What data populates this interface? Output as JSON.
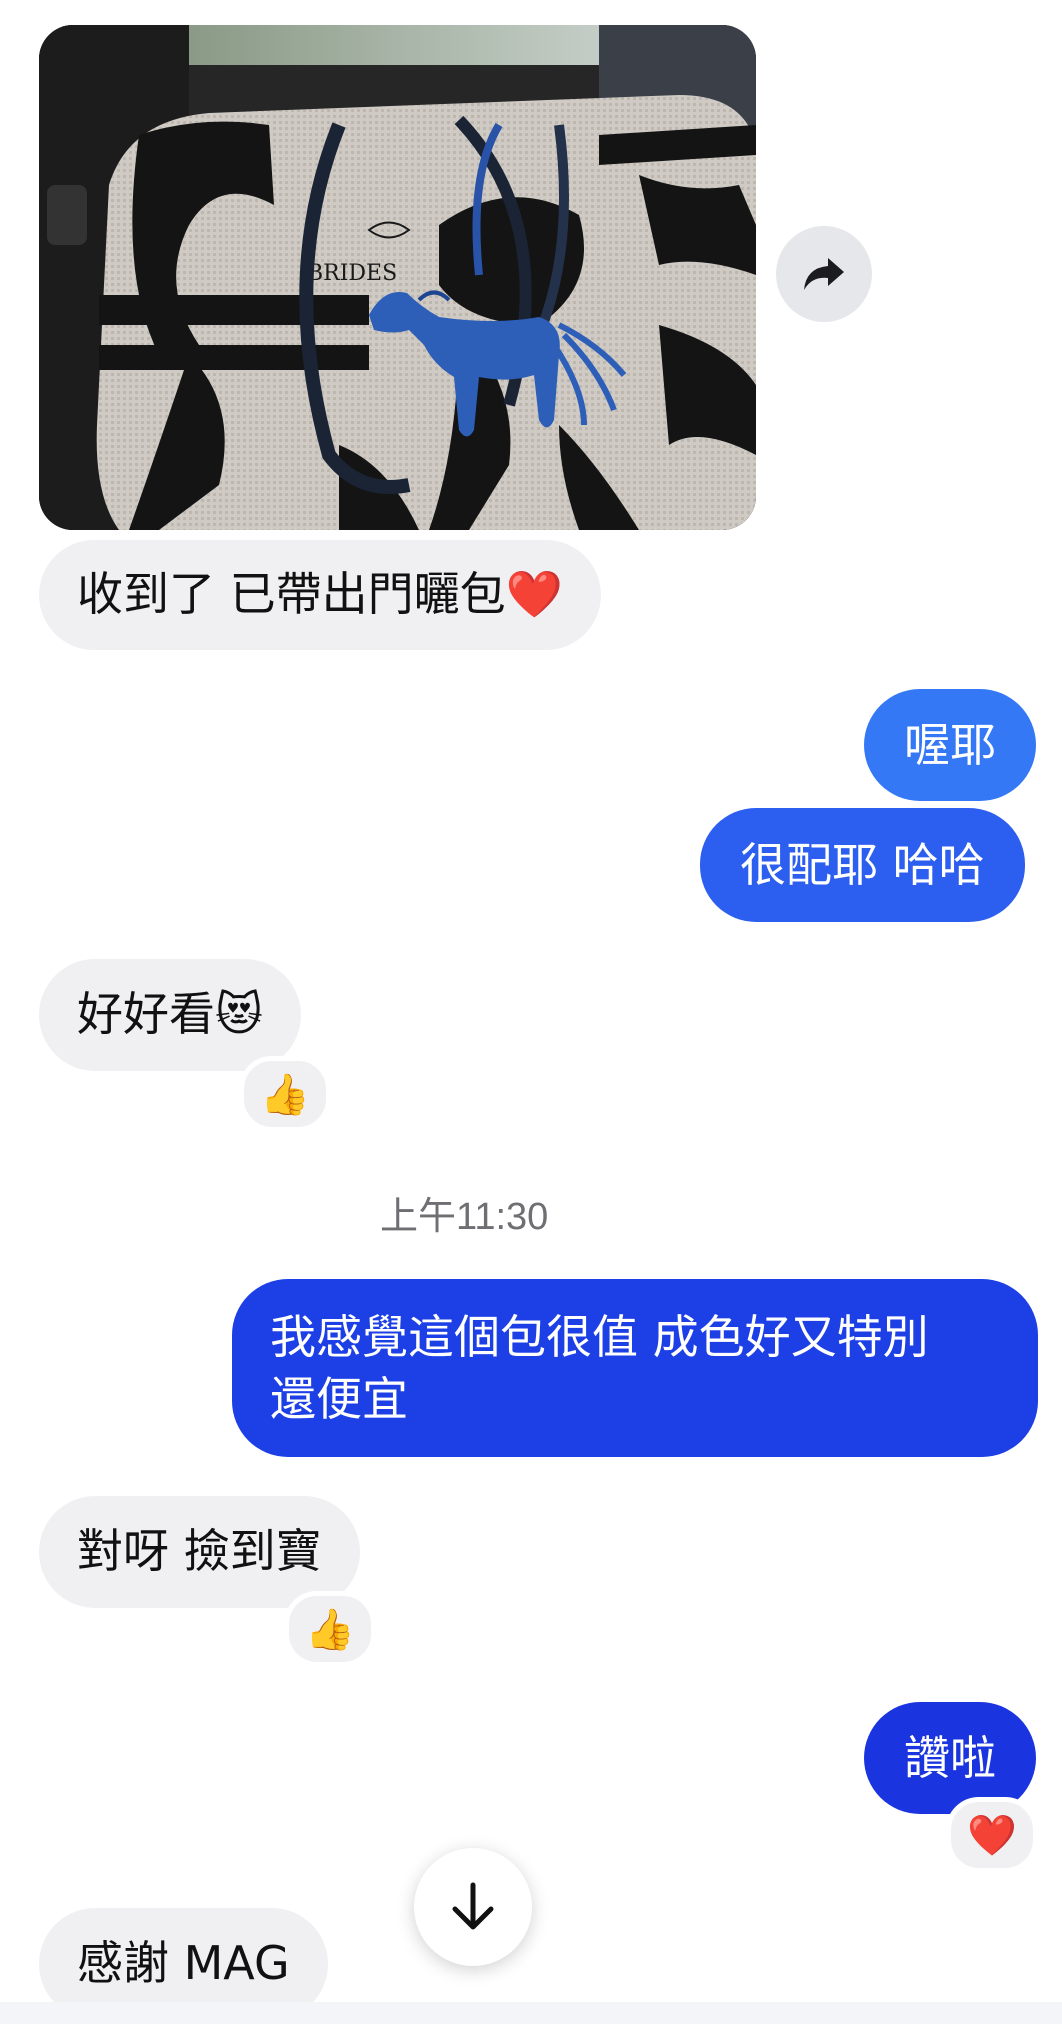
{
  "conversation": {
    "photo_icon": "bag-photo",
    "share_icon": "share-arrow-icon",
    "messages": [
      {
        "id": "m1",
        "direction": "incoming",
        "text": "收到了 已帶出門曬包",
        "emoji": "❤️"
      },
      {
        "id": "m2",
        "direction": "outgoing",
        "text": "喔耶"
      },
      {
        "id": "m3",
        "direction": "outgoing",
        "text": "很配耶 哈哈"
      },
      {
        "id": "m4",
        "direction": "incoming",
        "text": "好好看",
        "emoji": "😻",
        "reaction": "👍"
      },
      {
        "id": "m5",
        "direction": "outgoing",
        "lines": [
          "我感覺這個包很值 成色好又特別",
          "還便宜"
        ]
      },
      {
        "id": "m6",
        "direction": "incoming",
        "text": "對呀 撿到寶",
        "reaction": "👍"
      },
      {
        "id": "m7",
        "direction": "outgoing",
        "text": "讚啦",
        "reaction": "❤️"
      },
      {
        "id": "m8",
        "direction": "incoming",
        "text": "感謝 MAG"
      }
    ],
    "timestamp": "上午11:30"
  },
  "colors": {
    "incoming_bubble": "#f0f0f3",
    "outgoing_light": "#3478f6",
    "outgoing_mid": "#2c5ff0",
    "outgoing_dark": "#1c3fe6",
    "outgoing_darkest": "#1a34e0"
  },
  "scroll_icon": "arrow-down-icon"
}
